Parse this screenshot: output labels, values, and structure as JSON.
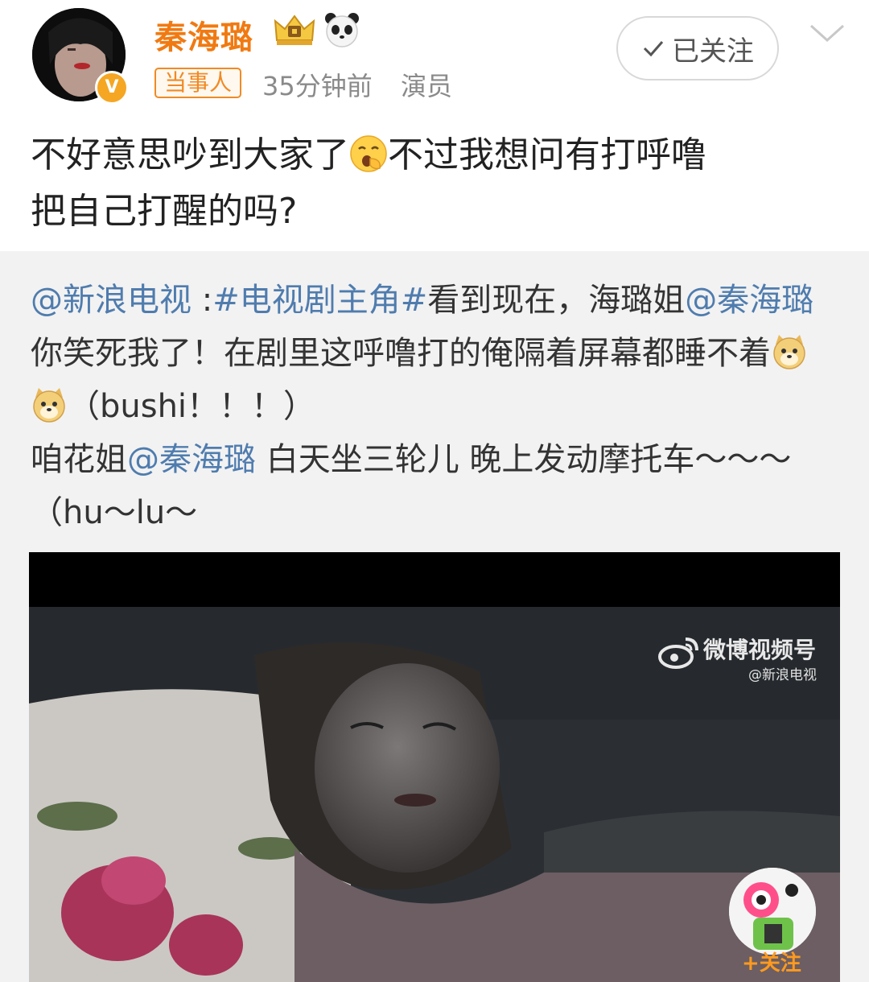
{
  "author": {
    "name": "秦海璐",
    "tag": "当事人",
    "time": "35分钟前",
    "role": "演员"
  },
  "follow_button": {
    "label": "已关注"
  },
  "post": {
    "line1_before": "不好意思吵到大家了",
    "line1_after": "不过我想问有打呼噜",
    "line2": "把自己打醒的吗?"
  },
  "repost": {
    "mention_source": "@新浪电视",
    "topic_sep": " :",
    "topic": "#电视剧主角#",
    "text_a": "看到现在，海璐姐",
    "mention_1": "@秦海璐",
    "text_b": " 你笑死我了！在剧里这呼噜打的俺隔着屏幕都睡不着",
    "text_c": "（bushi！！！）",
    "text_d": "咱花姐",
    "mention_2": "@秦海璐",
    "text_e": " 白天坐三轮儿 晚上发动摩托车～～～（hu～lu～"
  },
  "video": {
    "watermark_title": "微博视频号",
    "watermark_sub": "@新浪电视",
    "follow_label": "+关注"
  },
  "icons": {
    "verified": "verified-v-icon",
    "crown": "crown-badge-icon",
    "panda": "panda-badge-icon",
    "check": "check-icon",
    "chevron": "chevron-down-icon",
    "yawn_emoji": "yawn-emoji-icon",
    "doge": "doge-emoji-icon",
    "weibo": "weibo-logo-icon"
  },
  "colors": {
    "username": "#f07a12",
    "link": "#4f7cae",
    "tag": "#f08a24",
    "repost_bg": "#f2f2f2"
  }
}
